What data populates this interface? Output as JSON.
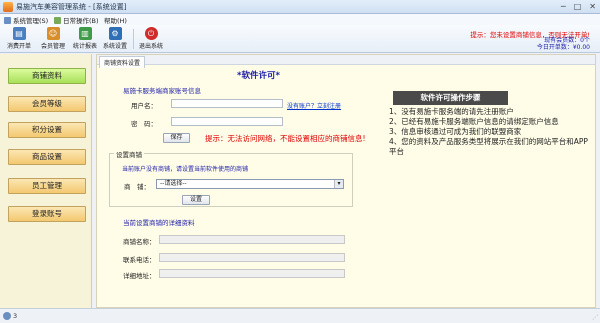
{
  "window": {
    "title": "易施汽车美容管理系统 - [系统设置]",
    "controls": [
      "─",
      "□",
      "✕"
    ]
  },
  "menu": [
    {
      "label": "系统管理(S)"
    },
    {
      "label": "日常操作(B)"
    },
    {
      "label": "帮助(H)"
    }
  ],
  "toolbar": [
    {
      "label": "消费开单",
      "icon": "receipt-icon",
      "color": "#4a7fc1",
      "glyph": "▤"
    },
    {
      "label": "会员管理",
      "icon": "member-icon",
      "color": "#d98e2c",
      "glyph": "☺"
    },
    {
      "label": "统计报表",
      "icon": "chart-icon",
      "color": "#3f9b4a",
      "glyph": "▥"
    },
    {
      "label": "系统设置",
      "icon": "gear-icon",
      "color": "#2f6fb5",
      "glyph": "⚙"
    },
    {
      "label": "退出系统",
      "icon": "power-icon",
      "color": "#d12a2a",
      "glyph": "⏻"
    }
  ],
  "header_right": {
    "notice": "提示：您未设置商铺信息，否则无法开单!",
    "member_count": "现有会员数：0个",
    "today_income": "今日开单数：¥0.00"
  },
  "sidebar": [
    {
      "label": "商铺资料",
      "active": true
    },
    {
      "label": "会员等级",
      "active": false
    },
    {
      "label": "积分设置",
      "active": false
    },
    {
      "label": "商品设置",
      "active": false
    },
    {
      "label": "员工管理",
      "active": false
    },
    {
      "label": "登录账号",
      "active": false
    }
  ],
  "content": {
    "tab_label": "商铺资料设置",
    "license_title": "*软件许可*",
    "account_section": {
      "title": "易施卡服务端商家账号信息",
      "username_label": "用户名：",
      "password_label": "密　码：",
      "register_link": "没有账户？立刻注册",
      "save_button": "保存"
    },
    "warning": "提示：无法访问网络，不能设置相应的商铺信息!",
    "shop_group": {
      "title": "设置商铺",
      "hint": "当前账户没有商铺，请设置当前软件使用的商铺",
      "shop_label": "商　铺：",
      "shop_select": "--请选择--",
      "set_button": "设置"
    },
    "details": {
      "title": "当前设置商铺的详细资料",
      "name_label": "商铺名称：",
      "phone_label": "联系电话：",
      "address_label": "详细地址："
    },
    "steps": {
      "banner": "软件许可操作步骤",
      "items": [
        "1、没有易施卡服务端的请先注册账户",
        "2、已经有易施卡服务端账户信息的请绑定账户信息",
        "3、信息审核通过可成为我们的联盟商家",
        "4、您的资料及产品服务类型将展示在我们的网站平台和APP平台"
      ]
    }
  },
  "statusbar": {
    "text": "3"
  }
}
